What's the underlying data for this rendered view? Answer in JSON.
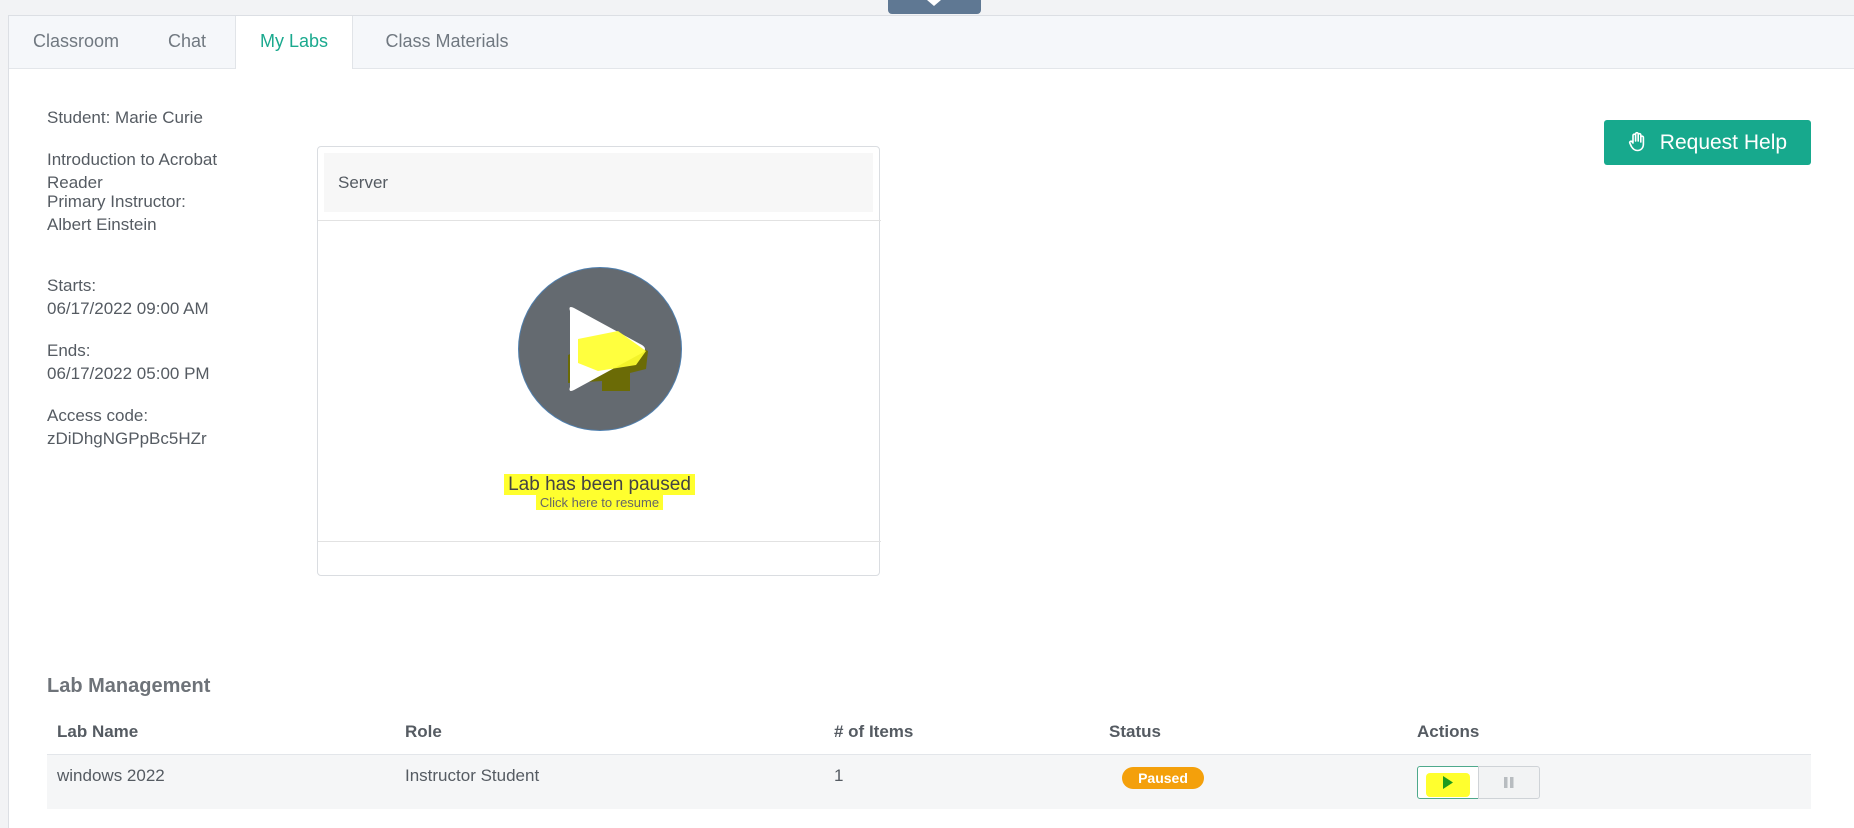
{
  "tabs": [
    {
      "label": "Classroom"
    },
    {
      "label": "Chat"
    },
    {
      "label": "My Labs"
    },
    {
      "label": "Class Materials"
    }
  ],
  "active_tab": "My Labs",
  "info": {
    "student": "Student: Marie Curie",
    "course_line1": "Introduction to Acrobat",
    "course_line2": "Reader",
    "instructor_label": "Primary Instructor:",
    "instructor_name": "Albert Einstein",
    "starts_label": "Starts:",
    "starts_value": "06/17/2022 09:00 AM",
    "ends_label": "Ends:",
    "ends_value": "06/17/2022 05:00 PM",
    "access_label": "Access code:",
    "access_value": "zDiDhgNGPpBc5HZr"
  },
  "request_help": {
    "label": "Request Help",
    "icon": "hand-icon"
  },
  "server": {
    "header": "Server",
    "paused_title": "Lab has been paused",
    "resume_hint": "Click here to resume",
    "icon": "play-icon"
  },
  "lab_management": {
    "title": "Lab Management",
    "columns": [
      "Lab Name",
      "Role",
      "# of Items",
      "Status",
      "Actions"
    ],
    "rows": [
      {
        "lab_name": "windows 2022",
        "role": "Instructor Student",
        "items": "1",
        "status": "Paused"
      }
    ]
  },
  "colors": {
    "accent": "#17a98d",
    "status_paused": "#f4a00b",
    "highlight": "#ffff2e"
  }
}
